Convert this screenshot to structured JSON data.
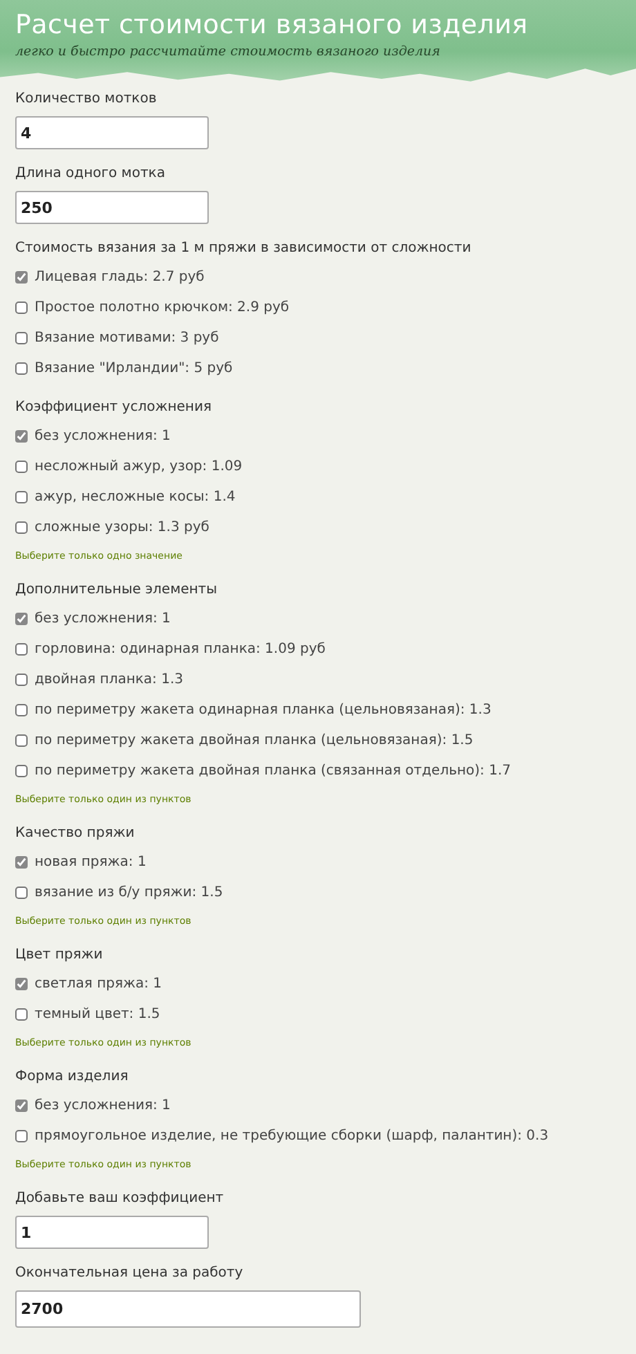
{
  "header": {
    "title": "Расчет стоимости вязаного изделия",
    "subtitle": "легко и быстро рассчитайте стоимость вязаного изделия"
  },
  "sections": [
    {
      "kind": "input",
      "label": "Количество мотков",
      "value": "4"
    },
    {
      "kind": "input",
      "label": "Длина одного мотка",
      "value": "250"
    },
    {
      "kind": "options",
      "label": "Стоимость вязания за 1 м пряжи в зависимости от сложности",
      "options": [
        {
          "label": "Лицевая гладь: 2.7 руб",
          "checked": true
        },
        {
          "label": "Простое полотно крючком: 2.9 руб",
          "checked": false
        },
        {
          "label": "Вязание мотивами: 3 руб",
          "checked": false
        },
        {
          "label": "Вязание \"Ирландии\": 5 руб",
          "checked": false
        }
      ]
    },
    {
      "kind": "options",
      "label": "Коэффициент усложнения",
      "hint": "Выберите только одно значение",
      "options": [
        {
          "label": "без усложнения: 1",
          "checked": true
        },
        {
          "label": "несложный ажур, узор: 1.09",
          "checked": false
        },
        {
          "label": "ажур, несложные косы: 1.4",
          "checked": false
        },
        {
          "label": "сложные узоры: 1.3 руб",
          "checked": false
        }
      ]
    },
    {
      "kind": "options",
      "label": "Дополнительные элементы",
      "hint": "Выберите только один из пунктов",
      "options": [
        {
          "label": "без усложнения: 1",
          "checked": true
        },
        {
          "label": "горловина: одинарная планка: 1.09 руб",
          "checked": false
        },
        {
          "label": "двойная планка: 1.3",
          "checked": false
        },
        {
          "label": "по периметру жакета одинарная планка (цельновязаная): 1.3",
          "checked": false
        },
        {
          "label": "по периметру жакета двойная планка (цельновязаная): 1.5",
          "checked": false
        },
        {
          "label": "по периметру жакета двойная планка (связанная отдельно): 1.7",
          "checked": false
        }
      ]
    },
    {
      "kind": "options",
      "label": "Качество пряжи",
      "hint": "Выберите только один из пунктов",
      "options": [
        {
          "label": "новая пряжа: 1",
          "checked": true
        },
        {
          "label": "вязание из б/у пряжи: 1.5",
          "checked": false
        }
      ]
    },
    {
      "kind": "options",
      "label": "Цвет пряжи",
      "hint": "Выберите только один из пунктов",
      "options": [
        {
          "label": "светлая пряжа: 1",
          "checked": true
        },
        {
          "label": "темный цвет: 1.5",
          "checked": false
        }
      ]
    },
    {
      "kind": "options",
      "label": "Форма изделия",
      "hint": "Выберите только один из пунктов",
      "options": [
        {
          "label": "без усложнения: 1",
          "checked": true
        },
        {
          "label": "прямоугольное изделие, не требующие сборки (шарф, палантин): 0.3",
          "checked": false
        }
      ]
    },
    {
      "kind": "input",
      "label": "Добавьте ваш коэффициент",
      "value": "1"
    },
    {
      "kind": "result",
      "label": "Окончательная цена за работу",
      "value": "2700"
    }
  ]
}
